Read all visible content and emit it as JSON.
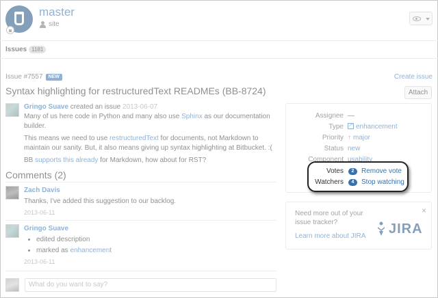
{
  "repo": {
    "name": "master",
    "owner": "site"
  },
  "tabs": {
    "issues_label": "Issues",
    "issues_count": "1181"
  },
  "issue": {
    "id": "Issue #7557",
    "badge": "NEW",
    "create_link": "Create issue",
    "title": "Syntax highlighting for restructuredText READMEs (BB-8724)",
    "attach_label": "Attach"
  },
  "description": {
    "author": "Gringo Suave",
    "action": " created an issue ",
    "date": "2013-06-07",
    "p1_before": "Many of us here code in Python and many also use ",
    "p1_link": "Sphinx",
    "p1_after": " as our documentation builder.",
    "p2_before": "This means we need to use ",
    "p2_link": "restructuredText",
    "p2_after": " for documents, not Markdown to maintain our sanity. But, it also means giving up syntax highlighting at Bitbucket. :(",
    "p3_before": "BB ",
    "p3_link": "supports this already",
    "p3_after": " for Markdown, how about for RST?"
  },
  "comments": {
    "heading": "Comments (2)",
    "items": [
      {
        "author": "Zach Davis",
        "text": "Thanks, I've added this suggestion to our backlog.",
        "date": "2013-06-11"
      },
      {
        "author": "Gringo Suave",
        "bullet1": "edited description",
        "bullet2_before": "marked as ",
        "bullet2_link": "enhancement",
        "date": "2013-06-11"
      }
    ],
    "reply_placeholder": "What do you want to say?"
  },
  "meta": {
    "assignee_label": "Assignee",
    "assignee_value": "—",
    "type_label": "Type",
    "type_value": "enhancement",
    "priority_label": "Priority",
    "priority_value": "major",
    "status_label": "Status",
    "status_value": "new",
    "component_label": "Component",
    "component_value": "usability",
    "votes_label": "Votes",
    "votes_count": "2",
    "votes_action": "Remove vote",
    "watchers_label": "Watchers",
    "watchers_count": "4",
    "watchers_action": "Stop watching"
  },
  "jira": {
    "text": "Need more out of your issue tracker?",
    "link": "Learn more about JIRA",
    "logo_text": "JIRA",
    "close": "×"
  },
  "colors": {
    "link": "#3572b0",
    "brand": "#205081",
    "priority": "#d04437"
  }
}
